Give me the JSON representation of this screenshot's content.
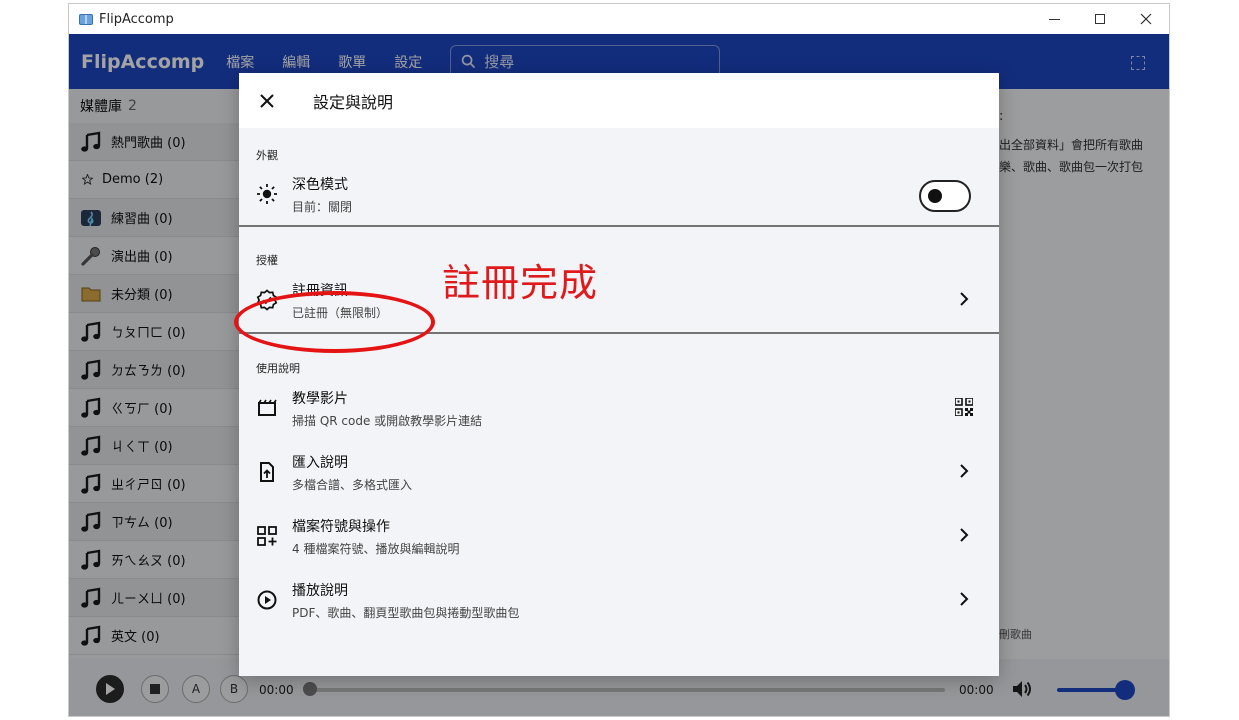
{
  "window": {
    "title": "FlipAccomp"
  },
  "appbar": {
    "brand": "FlipAccomp",
    "menus": [
      "檔案",
      "編輯",
      "歌單",
      "設定"
    ],
    "search_placeholder": "搜尋"
  },
  "sidebar": {
    "header": "媒體庫",
    "count": "2",
    "items": [
      {
        "label": "熱門歌曲 (0)",
        "icon": "music-note-icon"
      },
      {
        "label": "Demo (2)",
        "icon": "star-icon"
      },
      {
        "label": "練習曲 (0)",
        "icon": "treble-clef-icon"
      },
      {
        "label": "演出曲 (0)",
        "icon": "microphone-icon"
      },
      {
        "label": "未分類 (0)",
        "icon": "folder-icon"
      },
      {
        "label": "ㄅㄆㄇㄈ (0)",
        "icon": "music-note-icon"
      },
      {
        "label": "ㄉㄊㄋㄌ (0)",
        "icon": "music-note-icon"
      },
      {
        "label": "ㄍㄎㄏ (0)",
        "icon": "music-note-icon"
      },
      {
        "label": "ㄐㄑㄒ (0)",
        "icon": "music-note-icon"
      },
      {
        "label": "ㄓㄔㄕㄖ (0)",
        "icon": "music-note-icon"
      },
      {
        "label": "ㄗㄘㄙ (0)",
        "icon": "music-note-icon"
      },
      {
        "label": "ㄞㄟㄠㄡ (0)",
        "icon": "music-note-icon"
      },
      {
        "label": "ㄦㄧㄨㄩ (0)",
        "icon": "music-note-icon"
      },
      {
        "label": "英文 (0)",
        "icon": "music-note-icon"
      }
    ]
  },
  "content": {
    "colon": ":",
    "line1": "出全部資料」會把所有歌曲",
    "line2": "樂、歌曲、歌曲包一次打包",
    "footer": "刪歌曲"
  },
  "player": {
    "a_label": "A",
    "b_label": "B",
    "time_current": "00:00",
    "time_total": "00:00",
    "progress": 0,
    "volume": 0.95,
    "accent": "#1f47c4"
  },
  "dialog": {
    "title": "設定與說明",
    "sections": {
      "appearance": {
        "label": "外觀",
        "dark_mode": {
          "title": "深色模式",
          "subtitle": "目前：關閉",
          "enabled": false
        }
      },
      "license": {
        "label": "授權",
        "register": {
          "title": "註冊資訊",
          "subtitle": "已註冊（無限制）"
        }
      },
      "help": {
        "label": "使用說明",
        "items": [
          {
            "title": "教學影片",
            "subtitle": "掃描 QR code 或開啟教學影片連結",
            "icon": "clapperboard-icon",
            "trailing": "qr-code-icon"
          },
          {
            "title": "匯入說明",
            "subtitle": "多檔合譜、多格式匯入",
            "icon": "file-upload-icon",
            "trailing": "chevron-right-icon"
          },
          {
            "title": "檔案符號與操作",
            "subtitle": "4 種檔案符號、播放與編輯說明",
            "icon": "grid-add-icon",
            "trailing": "chevron-right-icon"
          },
          {
            "title": "播放說明",
            "subtitle": "PDF、歌曲、翻頁型歌曲包與捲動型歌曲包",
            "icon": "play-circle-icon",
            "trailing": "chevron-right-icon"
          }
        ]
      }
    }
  },
  "annotation": {
    "text": "註冊完成",
    "color": "#e0191b"
  }
}
